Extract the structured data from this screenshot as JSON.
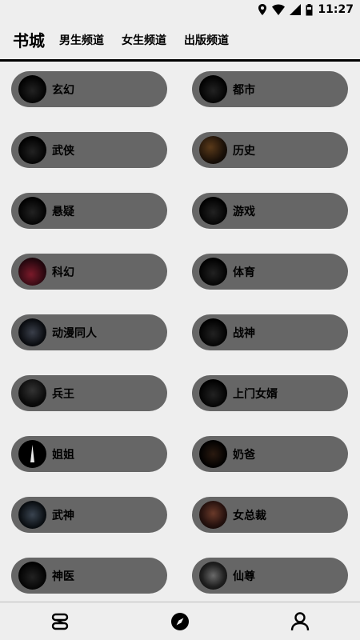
{
  "status_bar": {
    "time": "11:27",
    "icons": [
      "location-icon",
      "wifi-icon",
      "signal-icon",
      "battery-icon"
    ]
  },
  "header": {
    "title": "书城",
    "tabs": [
      {
        "label": "男生频道"
      },
      {
        "label": "女生频道"
      },
      {
        "label": "出版频道"
      }
    ]
  },
  "genres": [
    {
      "label": "玄幻"
    },
    {
      "label": "都市"
    },
    {
      "label": "武侠"
    },
    {
      "label": "历史"
    },
    {
      "label": "悬疑"
    },
    {
      "label": "游戏"
    },
    {
      "label": "科幻"
    },
    {
      "label": "体育"
    },
    {
      "label": "动漫同人"
    },
    {
      "label": "战神"
    },
    {
      "label": "兵王"
    },
    {
      "label": "上门女婿"
    },
    {
      "label": "姐姐"
    },
    {
      "label": "奶爸"
    },
    {
      "label": "武神"
    },
    {
      "label": "女总裁"
    },
    {
      "label": "神医"
    },
    {
      "label": "仙尊"
    }
  ],
  "bottom_nav": {
    "items": [
      {
        "icon": "bookstore-icon"
      },
      {
        "icon": "compass-icon"
      },
      {
        "icon": "profile-icon"
      }
    ]
  },
  "colors": {
    "background": "#eeeeee",
    "pill": "#666666",
    "text": "#000000"
  }
}
